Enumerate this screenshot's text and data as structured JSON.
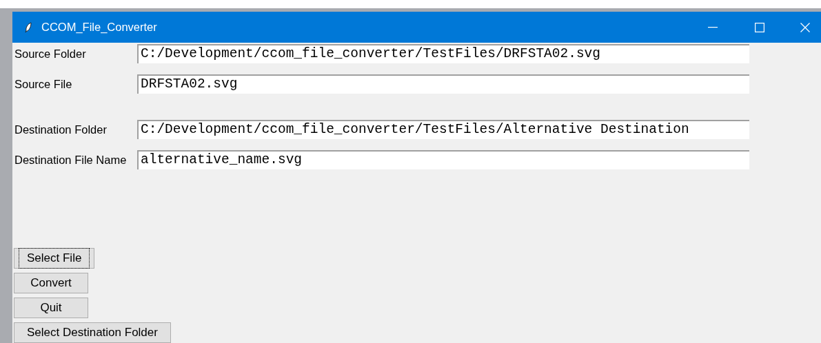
{
  "window": {
    "title": "CCOM_File_Converter"
  },
  "fields": [
    {
      "label": "Source Folder",
      "value": "C:/Development/ccom_file_converter/TestFiles/DRFSTA02.svg"
    },
    {
      "label": "Source File",
      "value": "DRFSTA02.svg"
    },
    {
      "label": "Destination Folder",
      "value": "C:/Development/ccom_file_converter/TestFiles/Alternative Destination"
    },
    {
      "label": "Destination File Name",
      "value": "alternative_name.svg"
    }
  ],
  "buttons": [
    {
      "label": "Select File",
      "focused": true
    },
    {
      "label": "Convert",
      "focused": false
    },
    {
      "label": "Quit",
      "focused": false
    },
    {
      "label": "Select Destination Folder",
      "focused": false
    }
  ]
}
